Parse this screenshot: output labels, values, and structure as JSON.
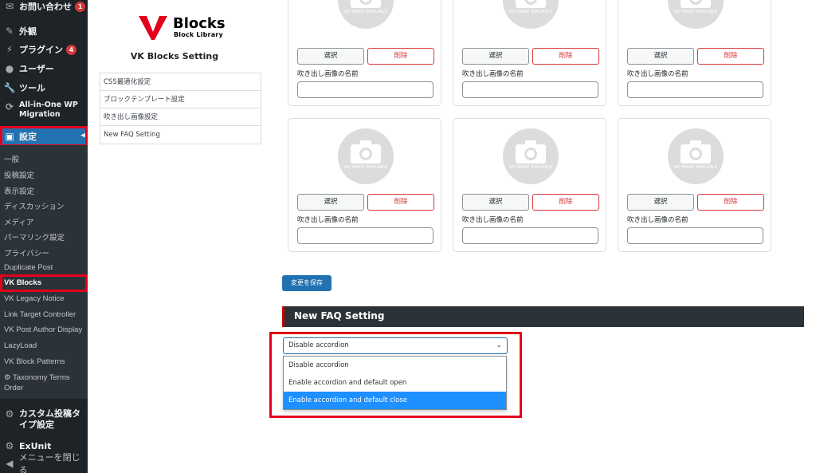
{
  "sidebar": {
    "items": [
      {
        "label": "お問い合わせ",
        "badge": "1",
        "icon": "mail-icon"
      },
      {
        "label": "外観",
        "icon": "paintbrush-icon"
      },
      {
        "label": "プラグイン",
        "badge": "4",
        "icon": "plugin-icon"
      },
      {
        "label": "ユーザー",
        "icon": "users-icon"
      },
      {
        "label": "ツール",
        "icon": "wrench-icon"
      },
      {
        "label": "All-in-One WP Migration",
        "icon": "migration-icon"
      },
      {
        "label": "設定",
        "icon": "settings-icon"
      }
    ],
    "submenu": [
      "一般",
      "投稿設定",
      "表示設定",
      "ディスカッション",
      "メディア",
      "パーマリンク設定",
      "プライバシー",
      "Duplicate Post",
      "VK Blocks",
      "VK Legacy Notice",
      "Link Target Controller",
      "VK Post Author Display",
      "LazyLoad",
      "VK Block Patterns",
      "Taxonomy Terms Order"
    ],
    "bottom": [
      {
        "label": "カスタム投稿タイプ設定",
        "icon": "gear-icon"
      },
      {
        "label": "ExUnit",
        "icon": "gear-icon"
      },
      {
        "label": "メニューを閉じる",
        "icon": "collapse-icon"
      }
    ]
  },
  "logo": {
    "title": "Blocks",
    "subtitle": "Block Library"
  },
  "settings_title": "VK Blocks Setting",
  "nav": [
    "CSS最適化設定",
    "ブロックテンプレート設定",
    "吹き出し画像設定",
    "New FAQ Setting"
  ],
  "card": {
    "select_label": "選択",
    "delete_label": "削除",
    "name_label": "吹き出し画像の名前",
    "placeholder_text": "NO IMAGE AVAILABLE"
  },
  "save_label": "変更を保存",
  "faq": {
    "header": "New FAQ Setting",
    "selected": "Disable accordion",
    "options": [
      "Disable accordion",
      "Enable accordion and default open",
      "Enable accordion and default close"
    ],
    "highlighted_index": 2
  },
  "colors": {
    "accent": "#2271b1",
    "highlight": "#e3001b",
    "sidebar": "#1d2327"
  }
}
